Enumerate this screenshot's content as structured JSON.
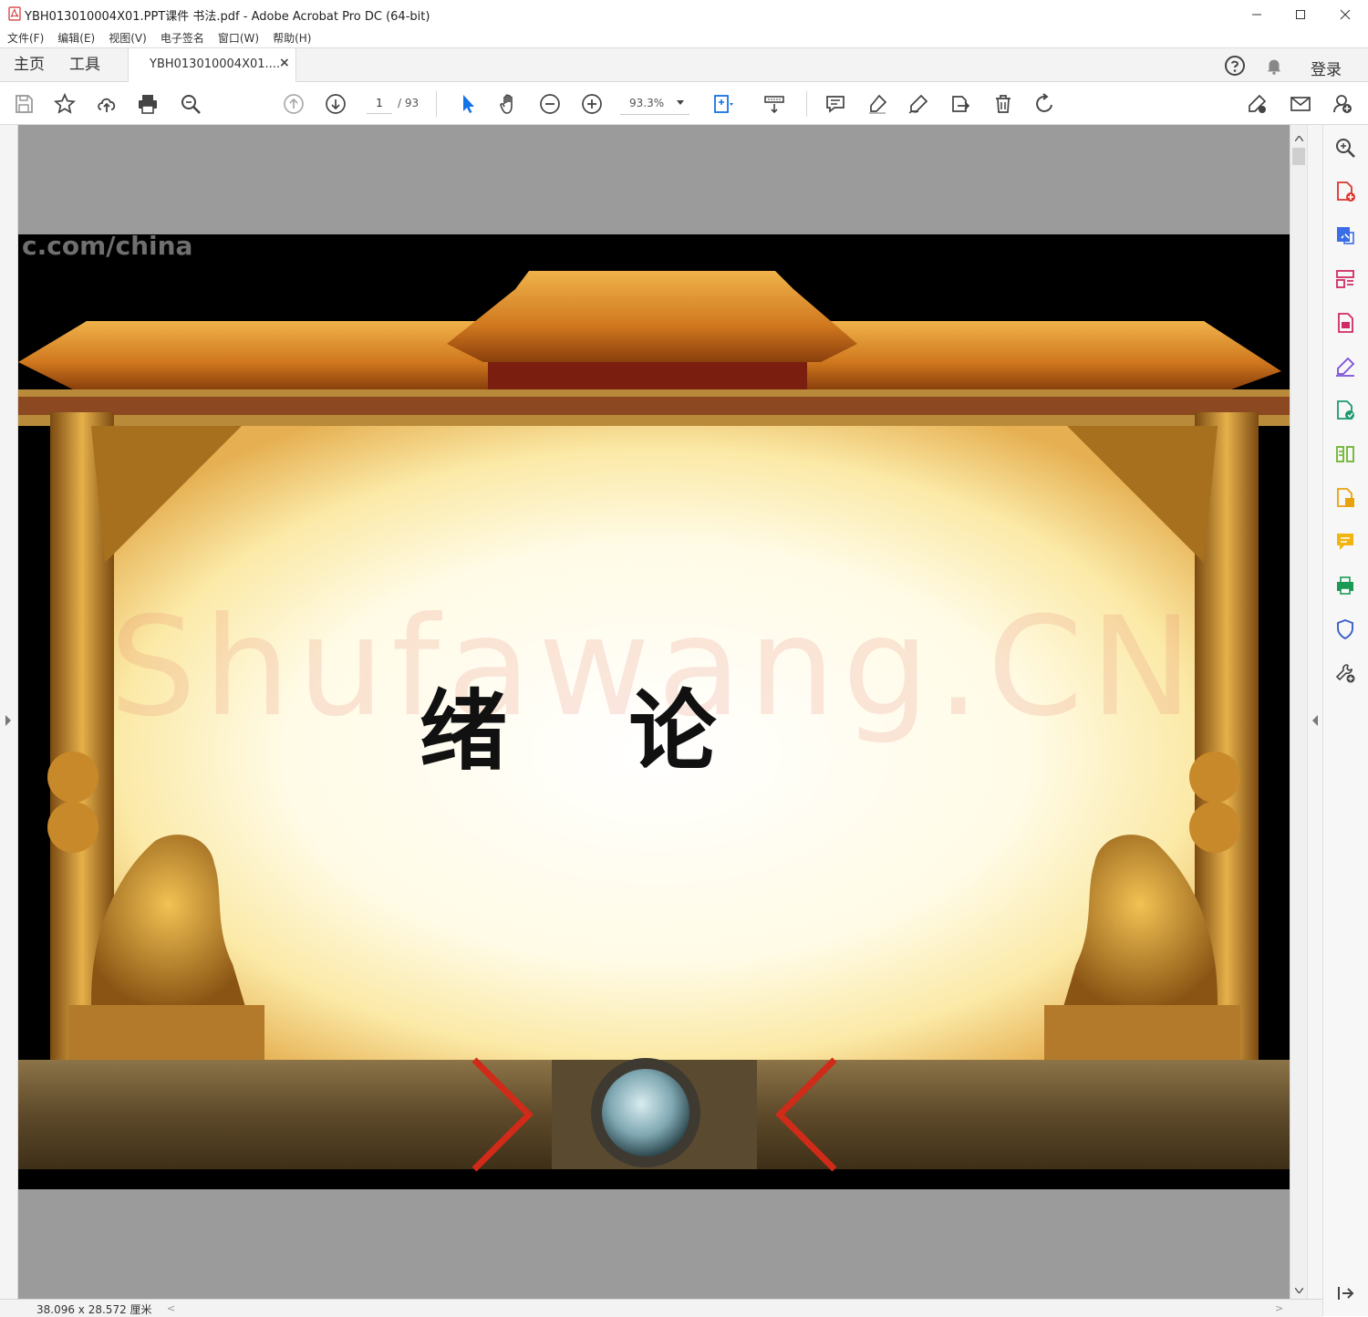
{
  "window": {
    "title": "YBH013010004X01.PPT课件 书法.pdf - Adobe Acrobat Pro DC (64-bit)"
  },
  "menu": {
    "items": [
      "文件(F)",
      "编辑(E)",
      "视图(V)",
      "电子签名",
      "窗口(W)",
      "帮助(H)"
    ]
  },
  "tabs": {
    "home": "主页",
    "tools": "工具",
    "document": "YBH013010004X01....",
    "close_glyph": "×",
    "login": "登录"
  },
  "toolbar": {
    "page_current": "1",
    "page_total": "/ 93",
    "zoom": "93.3%"
  },
  "document": {
    "heading": "绪 论",
    "watermark_text": "Shufawang.CN",
    "url_stamp": "c.com/china"
  },
  "status": {
    "page_size": "38.096 x 28.572 厘米"
  },
  "colors": {
    "accent_blue": "#1473e6",
    "doc_background": "#9b9b9b",
    "frame_gold": "#c8892a",
    "parchment": "#fff6cc"
  },
  "icons": {
    "toolbar": [
      "save-icon",
      "bookmark-star-icon",
      "upload-icon",
      "print-icon",
      "find-icon",
      "prev-page-icon",
      "next-page-icon",
      "select-arrow-icon",
      "hand-icon",
      "zoom-out-icon",
      "zoom-in-icon",
      "page-fit-icon",
      "scroll-mode-icon",
      "comment-icon",
      "highlight-icon",
      "sign-icon",
      "share-icon",
      "delete-icon",
      "rotate-icon",
      "fill-sign-icon",
      "email-icon",
      "add-user-icon"
    ],
    "right_rail": [
      "search-icon",
      "create-pdf-icon",
      "export-pdf-icon",
      "organize-pages-icon",
      "edit-pdf-icon",
      "fill-sign-icon",
      "combine-files-icon",
      "compare-icon",
      "export-icon",
      "comment-icon",
      "scan-icon",
      "protect-icon",
      "more-tools-icon"
    ]
  }
}
